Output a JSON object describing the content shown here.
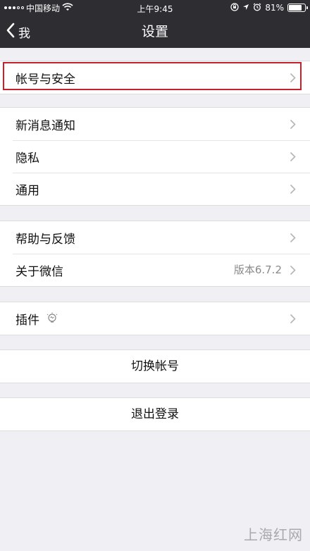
{
  "status_bar": {
    "carrier": "中国移动",
    "time": "上午9:45",
    "battery": "81%",
    "battery_level": 0.81
  },
  "nav": {
    "back_label": "我",
    "title": "设置"
  },
  "groups": {
    "account": {
      "items": [
        {
          "label": "帐号与安全"
        }
      ]
    },
    "general": {
      "items": [
        {
          "label": "新消息通知"
        },
        {
          "label": "隐私"
        },
        {
          "label": "通用"
        }
      ]
    },
    "about": {
      "items": [
        {
          "label": "帮助与反馈"
        },
        {
          "label": "关于微信",
          "value": "版本6.7.2"
        }
      ]
    },
    "plugins": {
      "items": [
        {
          "label": "插件"
        }
      ]
    }
  },
  "actions": {
    "switch_account": "切换帐号",
    "logout": "退出登录"
  },
  "watermark": "上海红网",
  "colors": {
    "highlight": "#c5202b",
    "navbar": "#2e2e32",
    "background": "#efeff4"
  }
}
